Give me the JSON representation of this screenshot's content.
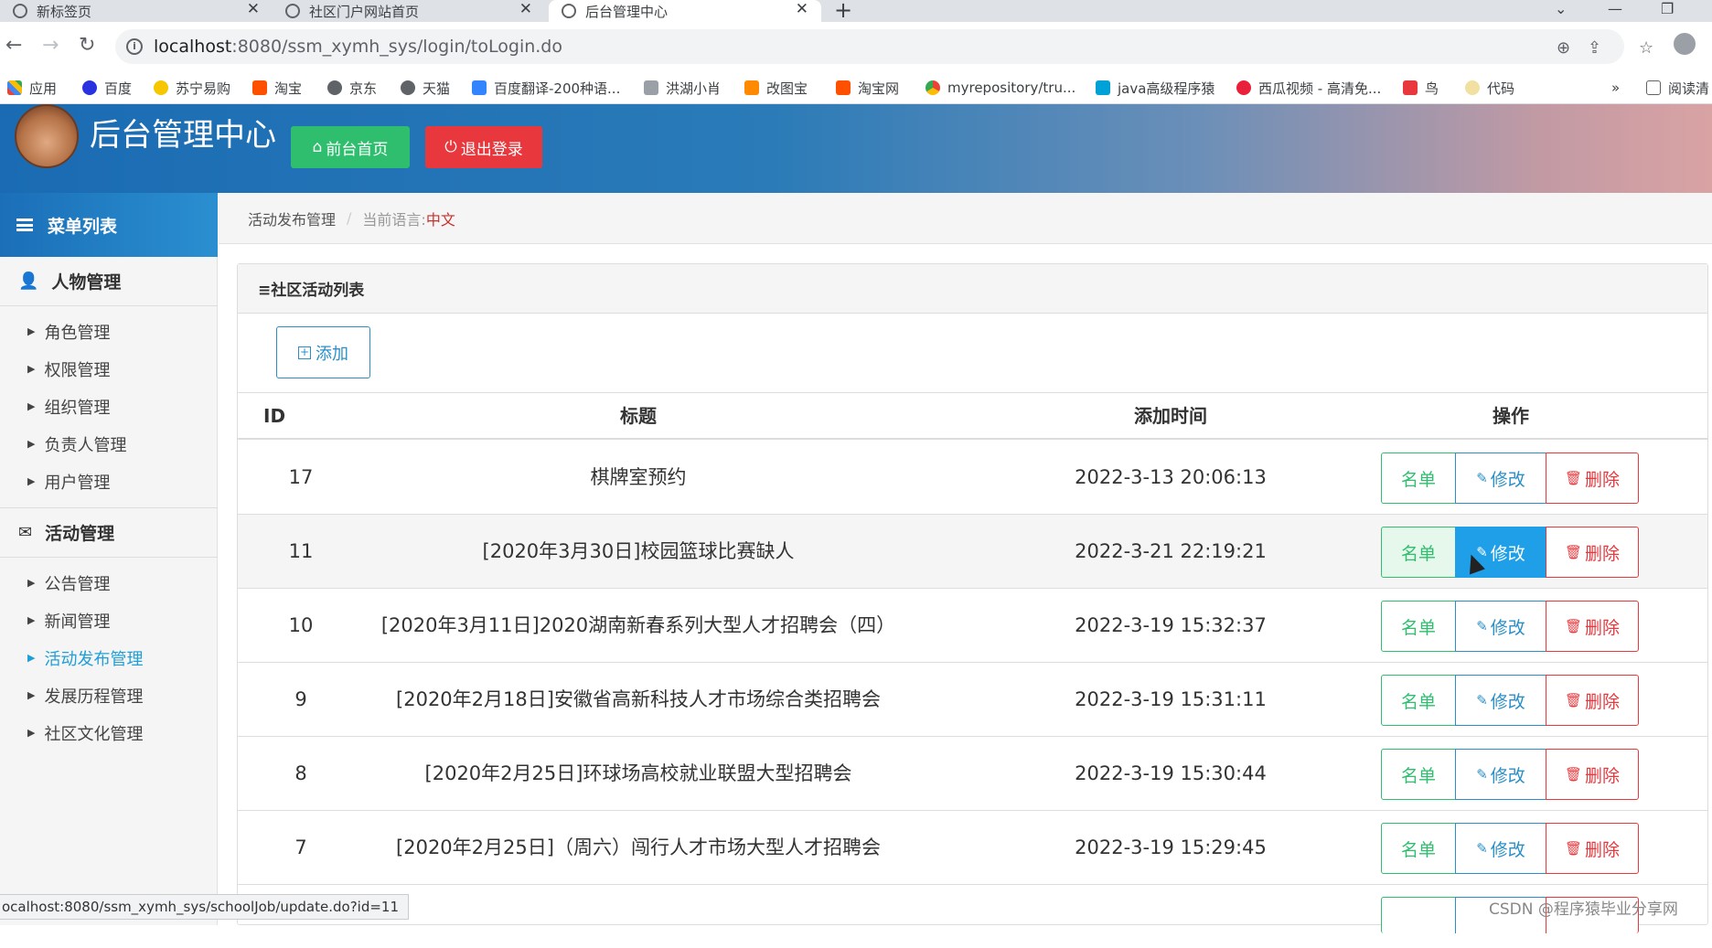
{
  "browser": {
    "tabs": [
      {
        "title": "新标签页"
      },
      {
        "title": "社区门户网站首页"
      },
      {
        "title": "后台管理中心"
      }
    ],
    "url_host": "localhost",
    "url_rest": ":8080/ssm_xymh_sys/login/toLogin.do",
    "bookmarks": [
      "应用",
      "百度",
      "苏宁易购",
      "淘宝",
      "京东",
      "天猫",
      "百度翻译-200种语...",
      "洪湖小肖",
      "改图宝",
      "淘宝网",
      "myrepository/tru...",
      "java高级程序猿",
      "西瓜视频 - 高清免...",
      "鸟",
      "代码"
    ],
    "bookmarks_overflow": "»",
    "reading_list": "阅读清"
  },
  "header": {
    "title": "后台管理中心",
    "home_button": "前台首页",
    "logout_button": "退出登录"
  },
  "sidebar": {
    "title": "菜单列表",
    "groups": [
      {
        "title": "人物管理",
        "items": [
          "角色管理",
          "权限管理",
          "组织管理",
          "负责人管理",
          "用户管理"
        ]
      },
      {
        "title": "活动管理",
        "items": [
          "公告管理",
          "新闻管理",
          "活动发布管理",
          "发展历程管理",
          "社区文化管理"
        ]
      }
    ],
    "active_item": "活动发布管理"
  },
  "breadcrumb": {
    "current": "活动发布管理",
    "lang_label": "当前语言:",
    "lang_value": "中文"
  },
  "panel": {
    "title": "≡社区活动列表",
    "add_button": "添加",
    "columns": [
      "ID",
      "标题",
      "添加时间",
      "操作"
    ],
    "actions": {
      "list": "名单",
      "edit": "修改",
      "delete": "删除"
    },
    "rows": [
      {
        "id": "17",
        "title": "棋牌室预约",
        "time": "2022-3-13 20:06:13"
      },
      {
        "id": "11",
        "title": "[2020年3月30日]校园篮球比赛缺人",
        "time": "2022-3-21 22:19:21"
      },
      {
        "id": "10",
        "title": "[2020年3月11日]2020湖南新春系列大型人才招聘会（四）",
        "time": "2022-3-19 15:32:37"
      },
      {
        "id": "9",
        "title": "[2020年2月18日]安徽省高新科技人才市场综合类招聘会",
        "time": "2022-3-19 15:31:11"
      },
      {
        "id": "8",
        "title": "[2020年2月25日]环球场高校就业联盟大型招聘会",
        "time": "2022-3-19 15:30:44"
      },
      {
        "id": "7",
        "title": "[2020年2月25日]（周六）闯行人才市场大型人才招聘会",
        "time": "2022-3-19 15:29:45"
      }
    ]
  },
  "status_url": "ocalhost:8080/ssm_xymh_sys/schoolJob/update.do?id=11",
  "watermark": "CSDN @程序猿毕业分享网"
}
